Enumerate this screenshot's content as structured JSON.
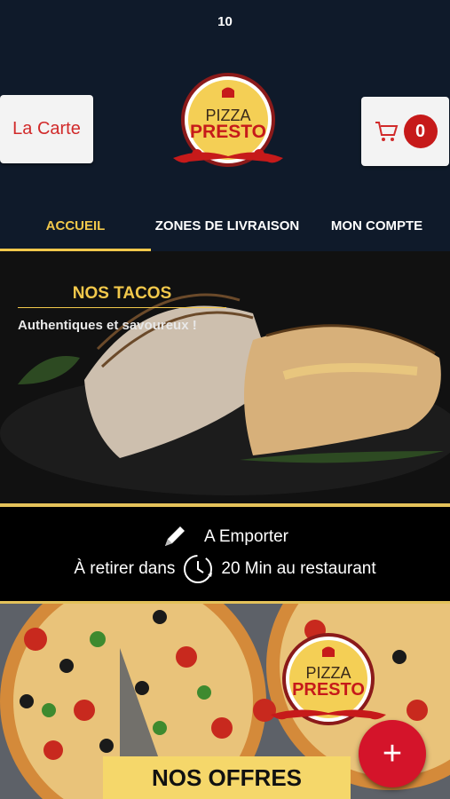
{
  "status": {
    "time": "10"
  },
  "header": {
    "menu_button": "La Carte",
    "cart_count": "0",
    "logo": {
      "line1": "PIZZA",
      "line2": "PRESTO"
    }
  },
  "tabs": [
    {
      "label": "ACCUEIL",
      "active": true
    },
    {
      "label": "ZONES DE LIVRAISON",
      "active": false
    },
    {
      "label": "MON COMPTE",
      "active": false
    }
  ],
  "hero": {
    "title": "NOS TACOS",
    "subtitle": "Authentiques et savoureux !"
  },
  "info": {
    "mode": "A Emporter",
    "prefix": "À retirer dans",
    "time": "20 Min au restaurant"
  },
  "promo": {
    "logo": {
      "line1": "PIZZA",
      "line2": "PRESTO"
    },
    "banner": "NOS OFFRES"
  },
  "fab": {
    "icon": "plus-icon"
  },
  "colors": {
    "gold": "#f2c84b",
    "red": "#d4142a",
    "navy": "#0f1a2a"
  }
}
